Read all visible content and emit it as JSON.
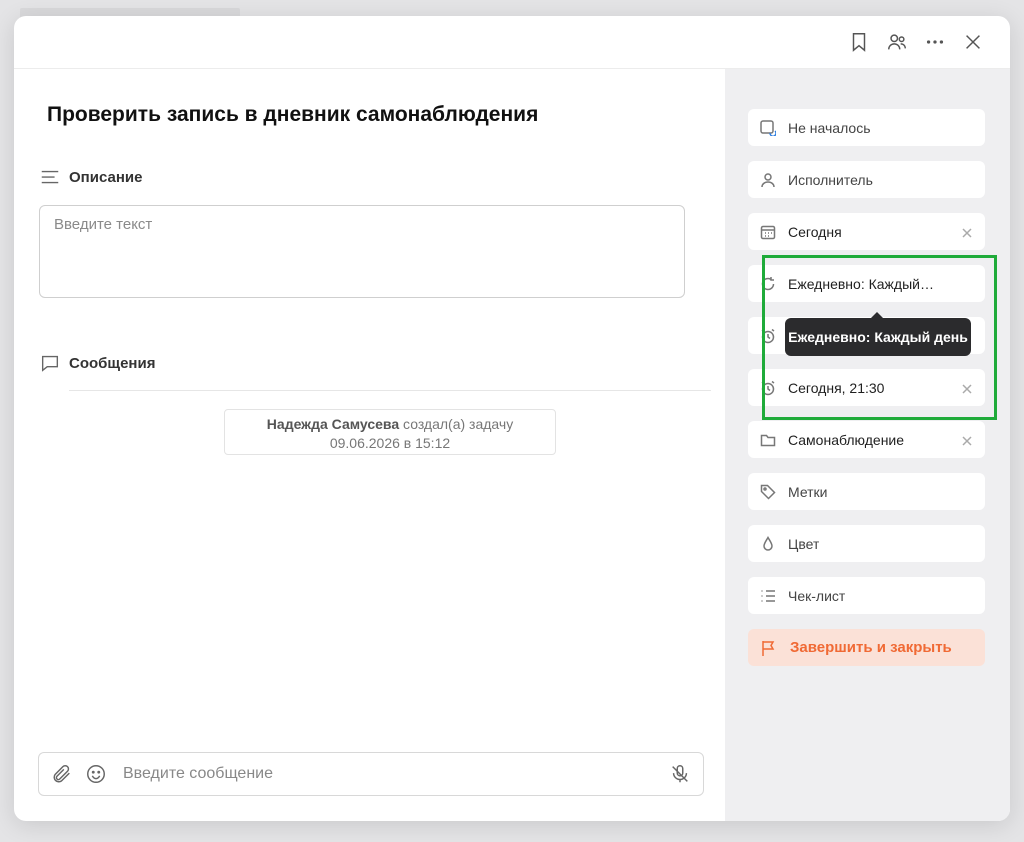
{
  "task": {
    "title": "Проверить запись в дневник самонаблюдения"
  },
  "description": {
    "label": "Описание",
    "placeholder": "Введите текст"
  },
  "messages": {
    "label": "Сообщения",
    "event_author": "Надежда Самусева",
    "event_action": "создал(а) задачу",
    "event_time": "09.06.2026 в 15:12",
    "input_placeholder": "Введите сообщение"
  },
  "sidebar": {
    "status": "Не началось",
    "assignee": "Исполнитель",
    "due_date": "Сегодня",
    "repeat": "Ежедневно: Каждый…",
    "repeat_tooltip": "Ежедневно: Каждый день",
    "reminder": "Сегодня, 21:30",
    "folder": "Самонаблюдение",
    "tags": "Метки",
    "color": "Цвет",
    "checklist": "Чек-лист",
    "finish": "Завершить и закрыть"
  },
  "colors": {
    "accent_orange": "#f06a35",
    "finish_bg": "#fbe1d7",
    "highlight_green": "#1fab3a",
    "sidebar_bg": "#efeff1"
  }
}
